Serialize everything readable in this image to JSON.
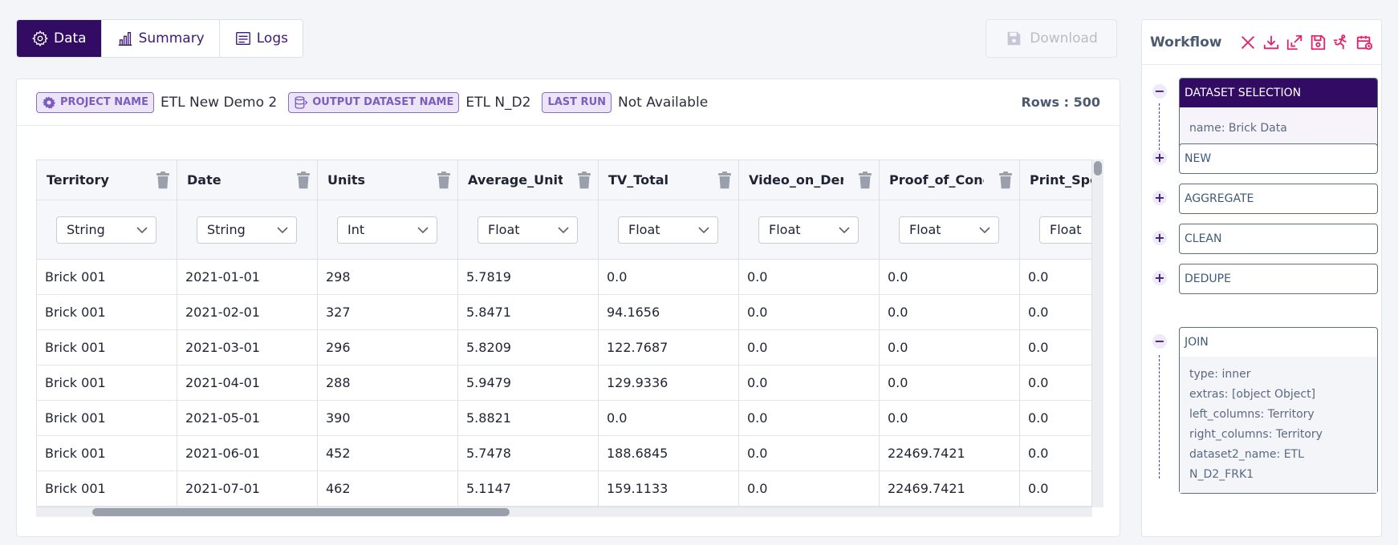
{
  "tabs": [
    {
      "label": "Data",
      "icon": "gear-icon",
      "active": true
    },
    {
      "label": "Summary",
      "icon": "bar-chart-icon",
      "active": false
    },
    {
      "label": "Logs",
      "icon": "log-list-icon",
      "active": false
    }
  ],
  "download": {
    "label": "Download",
    "icon": "floppy-disk-icon",
    "disabled": true
  },
  "info": {
    "project_badge": "PROJECT NAME",
    "project_value": "ETL New Demo 2",
    "output_badge": "OUTPUT DATASET NAME",
    "output_value": "ETL N_D2",
    "lastrun_badge": "LAST RUN",
    "lastrun_value": "Not Available",
    "rows": "Rows : 500"
  },
  "table": {
    "columns": [
      {
        "name": "Territory",
        "type": "String"
      },
      {
        "name": "Date",
        "type": "String"
      },
      {
        "name": "Units",
        "type": "Int"
      },
      {
        "name": "Average_Unit_",
        "type": "Float"
      },
      {
        "name": "TV_Total",
        "type": "Float"
      },
      {
        "name": "Video_on_Der",
        "type": "Float"
      },
      {
        "name": "Proof_of_Conc",
        "type": "Float"
      },
      {
        "name": "Print_Spen",
        "type": "Float"
      }
    ],
    "rows": [
      [
        "Brick 001",
        "2021-01-01",
        "298",
        "5.7819",
        "0.0",
        "0.0",
        "0.0",
        "0.0"
      ],
      [
        "Brick 001",
        "2021-02-01",
        "327",
        "5.8471",
        "94.1656",
        "0.0",
        "0.0",
        "0.0"
      ],
      [
        "Brick 001",
        "2021-03-01",
        "296",
        "5.8209",
        "122.7687",
        "0.0",
        "0.0",
        "0.0"
      ],
      [
        "Brick 001",
        "2021-04-01",
        "288",
        "5.9479",
        "129.9336",
        "0.0",
        "0.0",
        "0.0"
      ],
      [
        "Brick 001",
        "2021-05-01",
        "390",
        "5.8821",
        "0.0",
        "0.0",
        "0.0",
        "0.0"
      ],
      [
        "Brick 001",
        "2021-06-01",
        "452",
        "5.7478",
        "188.6845",
        "0.0",
        "22469.7421",
        "0.0"
      ],
      [
        "Brick 001",
        "2021-07-01",
        "462",
        "5.1147",
        "159.1133",
        "0.0",
        "22469.7421",
        "0.0"
      ]
    ]
  },
  "workflow": {
    "title": "Workflow",
    "tool_icons": [
      "close-icon",
      "import-icon",
      "export-icon",
      "save-icon",
      "auto-run-icon",
      "schedule-icon"
    ],
    "dataset_selection": {
      "title": "DATASET SELECTION",
      "toggle": "−",
      "detail": "name: Brick Data"
    },
    "steps": [
      {
        "label": "NEW",
        "toggle": "+"
      },
      {
        "label": "AGGREGATE",
        "toggle": "+"
      },
      {
        "label": "CLEAN",
        "toggle": "+"
      },
      {
        "label": "DEDUPE",
        "toggle": "+"
      }
    ],
    "join": {
      "title": "JOIN",
      "toggle": "−",
      "details": [
        "type: inner",
        "extras: [object Object]",
        "left_columns: Territory",
        "right_columns: Territory",
        "dataset2_name: ETL N_D2_FRK1"
      ]
    }
  },
  "colors": {
    "primary": "#320b63",
    "accent": "#e0246b",
    "badge": "#7d5cc0"
  }
}
